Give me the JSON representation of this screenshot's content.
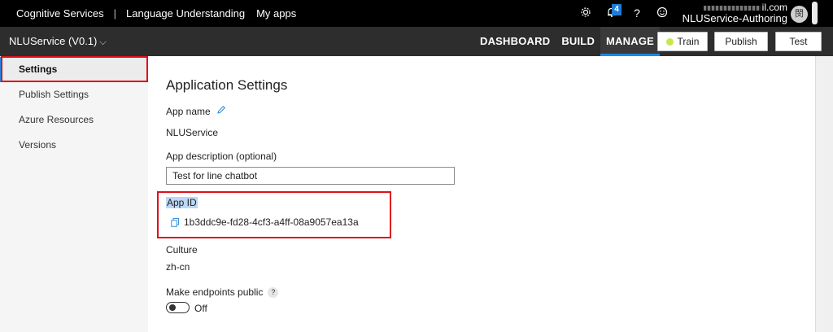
{
  "topbar": {
    "nav": [
      "Cognitive Services",
      "|",
      "Language Understanding",
      "My apps"
    ],
    "icons": [
      "gear-icon",
      "bell-icon",
      "help-icon",
      "smiley-icon"
    ],
    "notification_count": "4",
    "account_email_suffix": "il.com",
    "account_tenant": "NLUService-Authoring",
    "avatar_text": "閔"
  },
  "appbar": {
    "app_name": "NLUService (V0.1)",
    "chevron": "⌵",
    "tabs": [
      "DASHBOARD",
      "BUILD",
      "MANAGE"
    ],
    "active_tab": "MANAGE",
    "train_label": "Train",
    "publish_label": "Publish",
    "test_label": "Test",
    "train_status_color": "#c5e84e"
  },
  "sidebar": {
    "items": [
      {
        "label": "Settings",
        "active": true
      },
      {
        "label": "Publish Settings",
        "active": false
      },
      {
        "label": "Azure Resources",
        "active": false
      },
      {
        "label": "Versions",
        "active": false
      }
    ]
  },
  "main": {
    "title": "Application Settings",
    "app_name_label": "App name",
    "app_name_value": "NLUService",
    "description_label": "App description (optional)",
    "description_value": "Test for line chatbot",
    "app_id_label": "App ID",
    "app_id_value": "1b3ddc9e-fd28-4cf3-a4ff-08a9057ea13a",
    "culture_label": "Culture",
    "culture_value": "zh-cn",
    "endpoints_label": "Make endpoints public",
    "help_mark": "?",
    "toggle_state": "Off"
  },
  "colors": {
    "accent": "#1e88e5",
    "highlight": "#e0101a",
    "topbar": "#000000",
    "appbar": "#2d2d2d"
  }
}
